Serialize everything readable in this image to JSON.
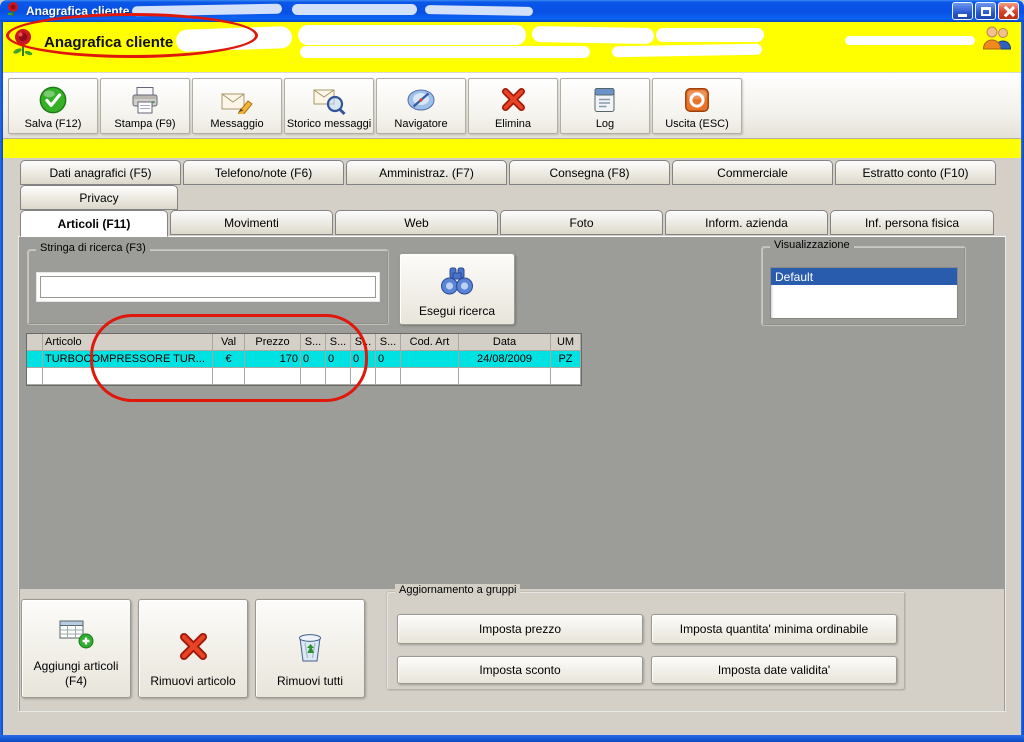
{
  "window": {
    "title": "Anagrafica cliente"
  },
  "header": {
    "title": "Anagrafica cliente"
  },
  "toolbar": {
    "buttons": [
      {
        "label": "Salva (F12)",
        "icon": "save-check-icon"
      },
      {
        "label": "Stampa (F9)",
        "icon": "printer-icon"
      },
      {
        "label": "Messaggio",
        "icon": "mail-compose-icon"
      },
      {
        "label": "Storico messaggi",
        "icon": "mail-history-icon"
      },
      {
        "label": "Navigatore",
        "icon": "navigator-compass-icon"
      },
      {
        "label": "Elimina",
        "icon": "delete-x-icon"
      },
      {
        "label": "Log",
        "icon": "log-icon"
      },
      {
        "label": "Uscita (ESC)",
        "icon": "exit-icon"
      }
    ]
  },
  "tabs": {
    "row1": [
      {
        "label": "Dati anagrafici (F5)"
      },
      {
        "label": "Telefono/note (F6)"
      },
      {
        "label": "Amministraz. (F7)"
      },
      {
        "label": "Consegna (F8)"
      },
      {
        "label": "Commerciale"
      },
      {
        "label": "Estratto conto (F10)"
      }
    ],
    "row2": [
      {
        "label": "Privacy"
      }
    ],
    "row3": [
      {
        "label": "Articoli (F11)",
        "active": true
      },
      {
        "label": "Movimenti"
      },
      {
        "label": "Web"
      },
      {
        "label": "Foto"
      },
      {
        "label": "Inform. azienda"
      },
      {
        "label": "Inf. persona fisica"
      }
    ],
    "active_tab": "Articoli (F11)"
  },
  "articoli_page": {
    "search_group": {
      "label": "Stringa di ricerca (F3)",
      "input_value": ""
    },
    "search_button": {
      "label": "Esegui ricerca",
      "icon": "binoculars-icon"
    },
    "visualizzazione_group": {
      "label": "Visualizzazione",
      "options": [
        "Default"
      ],
      "selected": "Default"
    },
    "table": {
      "headers": [
        "",
        "Articolo",
        "Val",
        "Prezzo",
        "S...",
        "S...",
        "S...",
        "S...",
        "Cod. Art",
        "Data",
        "UM"
      ],
      "rows": [
        [
          "",
          "TURBOCOMPRESSORE TUR...",
          "€",
          "170",
          "0",
          "0",
          "0",
          "0",
          "",
          "24/08/2009",
          "PZ"
        ]
      ]
    },
    "bottom_buttons": [
      {
        "label": "Aggiungi articoli (F4)",
        "icon": "add-table-icon"
      },
      {
        "label": "Rimuovi articolo",
        "icon": "remove-x-icon"
      },
      {
        "label": "Rimuovi tutti",
        "icon": "trash-icon"
      }
    ],
    "group_update": {
      "label": "Aggiornamento a gruppi",
      "buttons": [
        "Imposta prezzo",
        "Imposta quantita' minima ordinabile",
        "Imposta sconto",
        "Imposta date validita'"
      ]
    }
  },
  "colors": {
    "header_yellow": "#ffff00",
    "row_highlight_cyan": "#00e2e2",
    "annotation_red": "#e0180c",
    "list_selection_blue": "#2a5cae",
    "titlebar_blue": "#0850e4"
  }
}
